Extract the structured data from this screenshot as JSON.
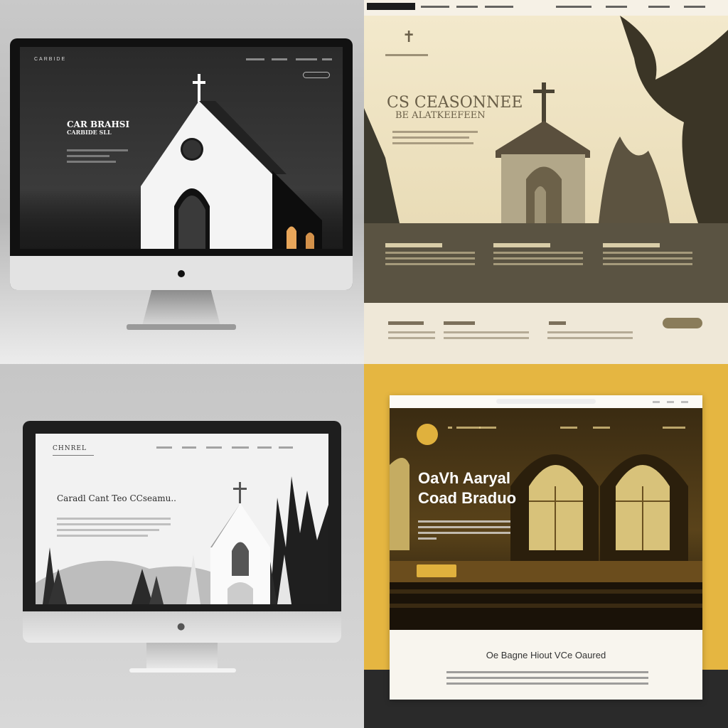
{
  "panel1": {
    "brand": "CARBIDE",
    "hero_line1": "CAR BRAHSI",
    "hero_line2": "CARBIDE SLL"
  },
  "panel2": {
    "hero_line1": "CS CEASONNEE",
    "hero_line2": "BE ALATKEEFEEN"
  },
  "panel3": {
    "brand": "CHNREL",
    "hero_title": "Caradl Cant Teo CCseamu.."
  },
  "panel4": {
    "hero_line1": "OaVh Aaryal",
    "hero_line2": "Coad Braduo",
    "section_title": "Oe Bagne Hiout VCe Oaured"
  },
  "colors": {
    "accent": "#e0b13d",
    "dark": "#1f1f1f",
    "olive": "#514a3a"
  }
}
